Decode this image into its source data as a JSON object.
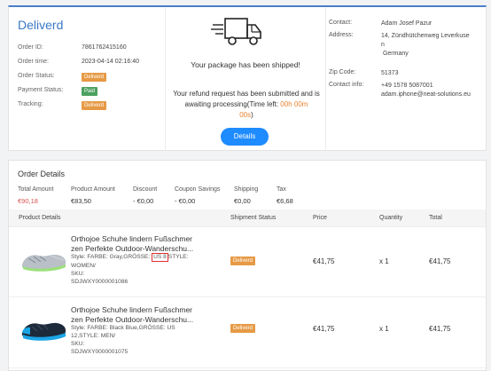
{
  "order": {
    "status_title": "Deliverd",
    "fields": [
      {
        "label": "Order ID:",
        "value": "7861762415160"
      },
      {
        "label": "Order time:",
        "value": "2023-04-14 02:16:40"
      },
      {
        "label": "Order Status:",
        "badge": "Deliverd"
      },
      {
        "label": "Payment Status:",
        "badge": "Paid"
      },
      {
        "label": "Tracking:",
        "badge": "Deliverd"
      }
    ]
  },
  "shipment": {
    "message": "Your package has been shipped!",
    "refund_text": "Your refund request has been submitted and is awaiting processing(Time left: ",
    "time_hours": "00h",
    "time_minutes": "00m",
    "time_seconds": "00s",
    "refund_end": ")",
    "details_button": "Details"
  },
  "contact": {
    "contact_label": "Contact:",
    "contact_value": "Adam Josef Pazur",
    "address_label": "Address:",
    "address_line1": "14, Zündhütchenweg Leverkuse",
    "address_line2": "n",
    "address_line3": "Germany",
    "zip_label": "Zip Code:",
    "zip_value": "51373",
    "info_label": "Contact info:",
    "info_phone": "+49 1578 5087001",
    "info_email": "adam.iphone@neat-solutions.eu"
  },
  "order_details": {
    "title": "Order Details",
    "summary": [
      {
        "label": "Total Amount",
        "value": "€90,18",
        "red": true
      },
      {
        "label": "Product Amount",
        "value": "€83,50"
      },
      {
        "label": "Discount",
        "value": "- €0,00"
      },
      {
        "label": "Coupon Savings",
        "value": "- €0,00"
      },
      {
        "label": "Shipping",
        "value": "€0,00"
      },
      {
        "label": "Tax",
        "value": "€6,68"
      }
    ],
    "columns": {
      "product": "Product Details",
      "shipment": "Shipment Status",
      "price": "Price",
      "quantity": "Quantity",
      "total": "Total"
    },
    "products": [
      {
        "name": "Orthojoe Schuhe lindern Fußschmer zen Perfekte Outdoor-Wanderschu...",
        "style_pre": "Style: FARBE: Gray,GRÖSSE: ",
        "style_boxed": "US 8",
        "style_post": "STYLE: WOMEN/",
        "sku_label": "SKU:",
        "sku": "SDJWXY0000001086",
        "status": "Deliverd",
        "price": "€41,75",
        "quantity": "x 1",
        "total": "€41,75"
      },
      {
        "name": "Orthojoe Schuhe lindern Fußschmer zen Perfekte Outdoor-Wanderschu...",
        "style_pre": "Style: FARBE: Black Blue,GRÖSSE: US 12,STYLE: MEN/",
        "style_boxed": "",
        "style_post": "",
        "sku_label": "SKU:",
        "sku": "SDJWXY0000001075",
        "status": "Deliverd",
        "price": "€41,75",
        "quantity": "x 1",
        "total": "€41,75"
      }
    ]
  },
  "colors": {
    "accent": "#3a78c5",
    "button": "#1e8bff",
    "badge_orange": "#e69a45",
    "badge_green": "#4ca05f",
    "total_red": "#d9534f",
    "highlight_box": "#e03030",
    "timer": "#e8832e"
  }
}
